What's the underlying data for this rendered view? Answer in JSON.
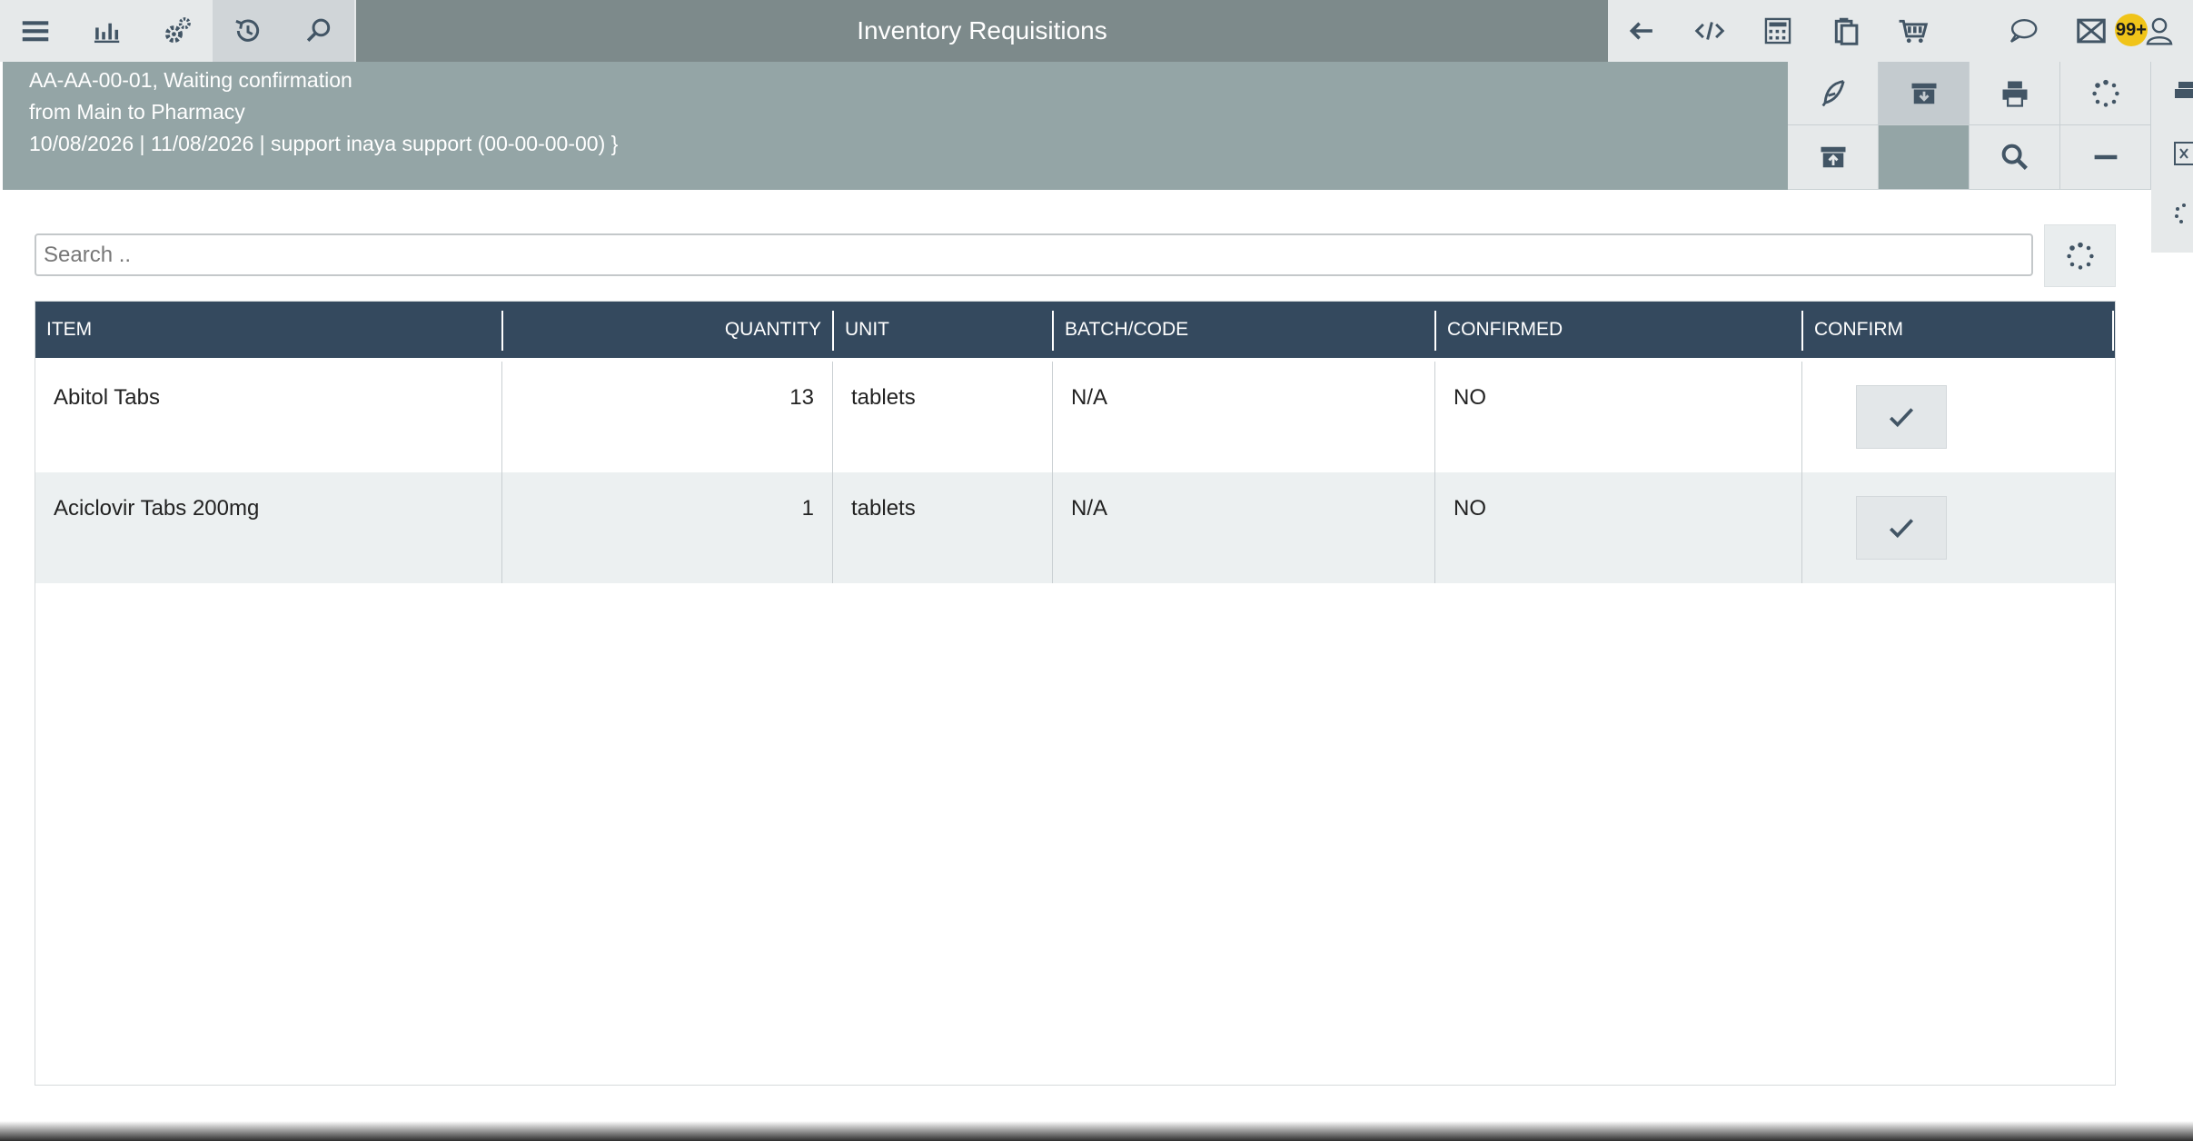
{
  "header": {
    "title": "Inventory Requisitions",
    "badge": "99+"
  },
  "document": {
    "line1": "AA-AA-00-01, Waiting confirmation",
    "line2": "from Main to Pharmacy",
    "line3": "10/08/2026 | 11/08/2026 | support inaya support (00-00-00-00) }"
  },
  "search": {
    "placeholder": "Search .."
  },
  "table": {
    "columns": [
      "ITEM",
      "QUANTITY",
      "UNIT",
      "BATCH/CODE",
      "CONFIRMED",
      "CONFIRM"
    ],
    "rows": [
      {
        "item": "Abitol Tabs",
        "quantity": "13",
        "unit": "tablets",
        "batch": "N/A",
        "confirmed": "NO"
      },
      {
        "item": "Aciclovir Tabs 200mg",
        "quantity": "1",
        "unit": "tablets",
        "batch": "N/A",
        "confirmed": "NO"
      }
    ]
  },
  "colors": {
    "topbar": "#7d8a8b",
    "subheader": "#94a5a6",
    "table_header": "#34495e",
    "badge": "#f0c419"
  },
  "icons": {
    "left_toolbar": [
      "menu-icon",
      "bar-chart-icon",
      "gears-icon",
      "history-icon",
      "search-icon"
    ],
    "right_toolbar": [
      "arrow-left-icon",
      "code-icon",
      "calculator-icon",
      "clipboard-icon",
      "cart-icon",
      "chat-icon",
      "mail-icon",
      "user-icon"
    ],
    "actions": [
      "feather-icon",
      "archive-download-icon",
      "print-icon",
      "spinner-icon",
      "archive-upload-icon",
      "search-icon",
      "minus-icon"
    ]
  }
}
